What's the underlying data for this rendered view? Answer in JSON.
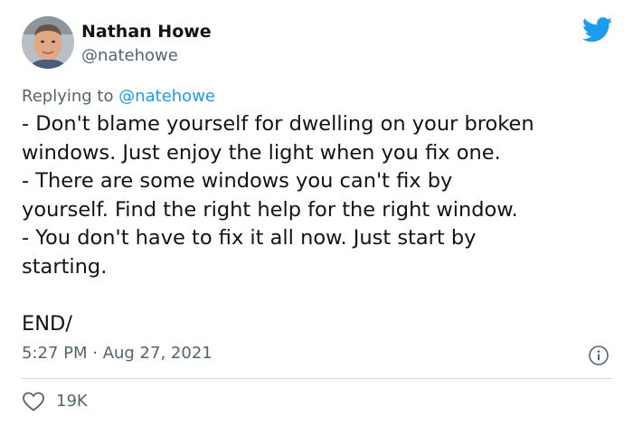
{
  "author": {
    "display_name": "Nathan Howe",
    "handle": "@natehowe"
  },
  "reply": {
    "prefix": "Replying to ",
    "mention": "@natehowe"
  },
  "tweet": {
    "text": "- Don't blame yourself for dwelling on your broken\nwindows. Just enjoy the light when you fix one.\n- There are some windows you can't fix by\nyourself. Find the right help for the right window.\n- You don't have to fix it all now. Just start by\nstarting.\n\nEND/"
  },
  "meta": {
    "timestamp": "5:27 PM · Aug 27, 2021"
  },
  "engagement": {
    "likes": "19K"
  },
  "icons": {
    "brand": "twitter-bird-icon",
    "info": "info-icon",
    "like": "heart-icon"
  },
  "colors": {
    "brand_blue": "#1d9bf0",
    "secondary_text": "#536471",
    "primary_text": "#0f1419",
    "divider": "#cfd9de"
  }
}
